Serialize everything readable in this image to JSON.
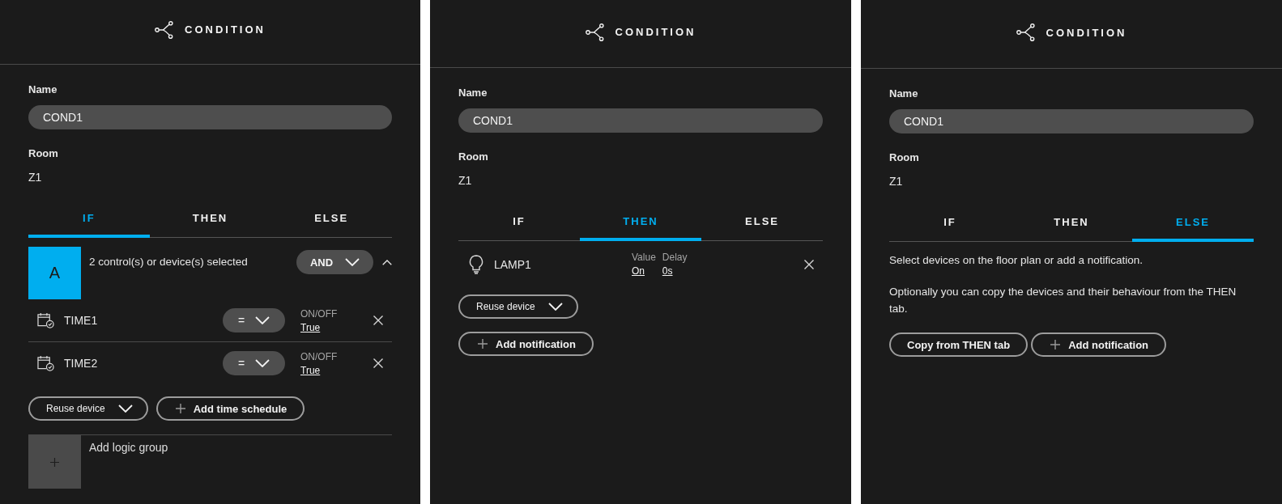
{
  "panels": [
    {
      "header": {
        "title": "CONDITION"
      },
      "name_field": {
        "label": "Name",
        "value": "COND1"
      },
      "room": {
        "label": "Room",
        "value": "Z1"
      },
      "tabs": [
        {
          "label": "IF",
          "selected": true
        },
        {
          "label": "THEN",
          "selected": false
        },
        {
          "label": "ELSE",
          "selected": false
        }
      ],
      "body": {
        "kind": "logic",
        "groups": [
          {
            "letter": "A",
            "summary": "2 control(s) or device(s) selected",
            "operator": "AND",
            "expanded": true,
            "items": [
              {
                "kind": "schedule",
                "name": "TIME1",
                "comparator": "=",
                "value_label": "ON/OFF",
                "value": "True"
              },
              {
                "kind": "schedule",
                "name": "TIME2",
                "comparator": "=",
                "value_label": "ON/OFF",
                "value": "True"
              }
            ]
          }
        ],
        "buttons": [
          {
            "kind": "dropdown",
            "label": "Reuse device"
          },
          {
            "kind": "add",
            "label": "Add time schedule"
          }
        ],
        "add_group": {
          "label": "Add logic group"
        }
      }
    },
    {
      "header": {
        "title": "CONDITION"
      },
      "name_field": {
        "label": "Name",
        "value": "COND1"
      },
      "room": {
        "label": "Room",
        "value": "Z1"
      },
      "tabs": [
        {
          "label": "IF",
          "selected": false
        },
        {
          "label": "THEN",
          "selected": true
        },
        {
          "label": "ELSE",
          "selected": false
        }
      ],
      "body": {
        "kind": "actions",
        "actions": [
          {
            "kind": "lamp",
            "name": "LAMP1",
            "fields": [
              {
                "label": "Value",
                "value": "On"
              },
              {
                "label": "Delay",
                "value": "0s"
              }
            ]
          }
        ],
        "buttons": [
          {
            "kind": "dropdown",
            "label": "Reuse device"
          },
          {
            "kind": "add",
            "label": "Add notification"
          }
        ]
      }
    },
    {
      "header": {
        "title": "CONDITION"
      },
      "name_field": {
        "label": "Name",
        "value": "COND1"
      },
      "room": {
        "label": "Room",
        "value": "Z1"
      },
      "tabs": [
        {
          "label": "IF",
          "selected": false
        },
        {
          "label": "THEN",
          "selected": false
        },
        {
          "label": "ELSE",
          "selected": true
        }
      ],
      "body": {
        "kind": "notice",
        "paragraphs": [
          "Select devices on the floor plan or add a notification.",
          "Optionally you can copy the devices and their behaviour from the THEN tab."
        ],
        "buttons": [
          {
            "kind": "plain",
            "label": "Copy from THEN tab"
          },
          {
            "kind": "add",
            "label": "Add notification"
          }
        ]
      }
    }
  ]
}
